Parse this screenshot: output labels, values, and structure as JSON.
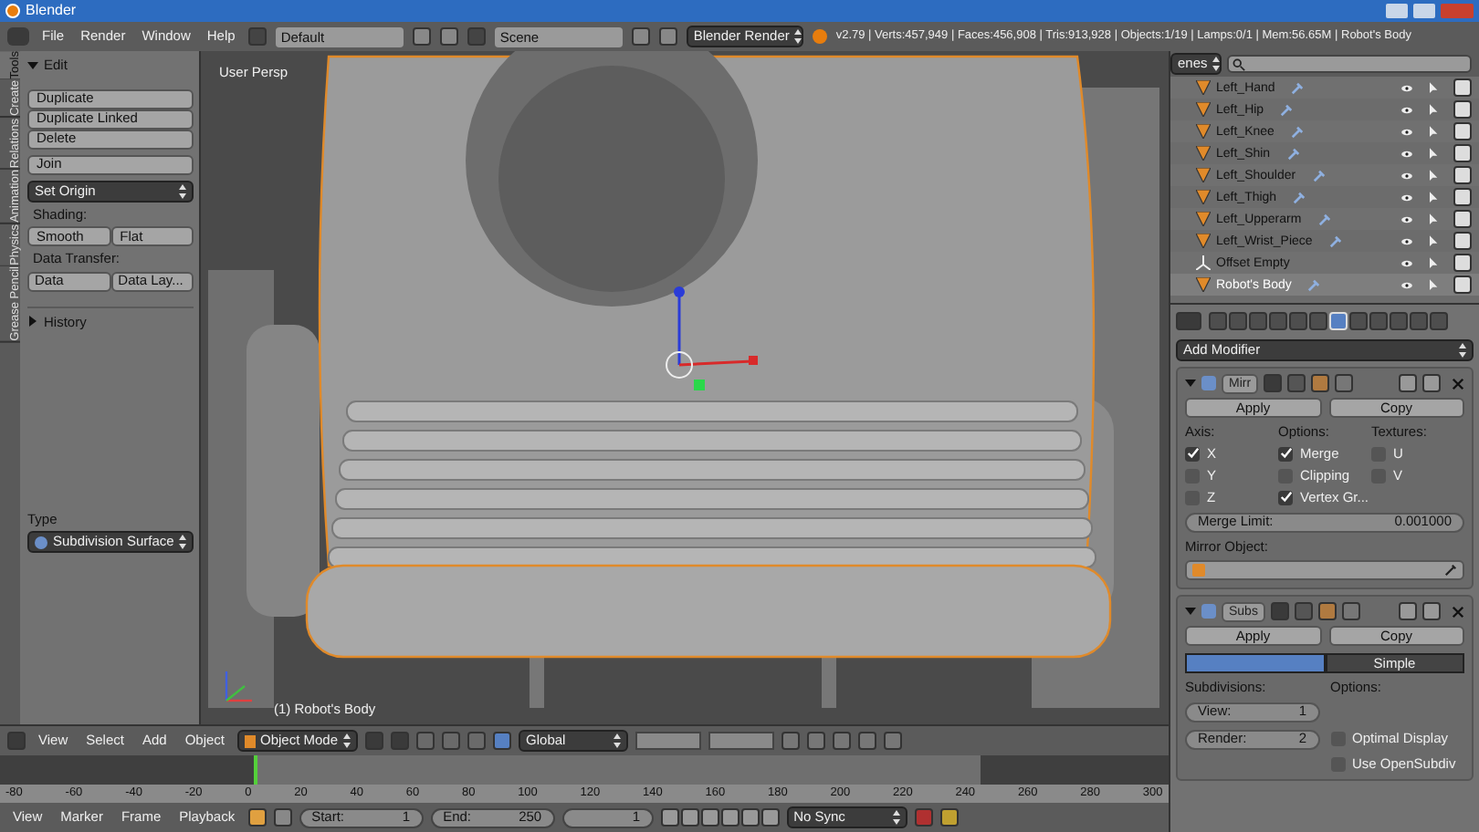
{
  "window": {
    "title": "Blender"
  },
  "menu_bar": {
    "menus": [
      "File",
      "Render",
      "Window",
      "Help"
    ],
    "layout": "Default",
    "scene": "Scene",
    "engine": "Blender Render",
    "stats": "v2.79 | Verts:457,949 | Faces:456,908 | Tris:913,928 | Objects:1/19 | Lamps:0/1 | Mem:56.65M | Robot's Body"
  },
  "tool_shelf": {
    "tabs": [
      {
        "label": "Tools",
        "selected": true
      },
      {
        "label": "Create",
        "selected": false
      },
      {
        "label": "Relations",
        "selected": false
      },
      {
        "label": "Animation",
        "selected": false
      },
      {
        "label": "Physics",
        "selected": false
      },
      {
        "label": "Grease Pencil",
        "selected": false
      }
    ],
    "edit_panel": {
      "title": "Edit",
      "expanded": true,
      "buttons": [
        "Duplicate",
        "Duplicate Linked",
        "Delete"
      ],
      "join": "Join",
      "set_origin": "Set Origin",
      "shading_label": "Shading:",
      "shading_buttons": [
        "Smooth",
        "Flat"
      ],
      "data_transfer_label": "Data Transfer:",
      "data_transfer_buttons": [
        "Data",
        "Data Lay..."
      ]
    },
    "history_panel": {
      "title": "History",
      "expanded": false
    },
    "operator": {
      "label": "Type",
      "value": "Subdivision Surface"
    }
  },
  "viewport": {
    "view_name": "User Persp",
    "object_label": "(1) Robot's Body"
  },
  "view3d_header": {
    "menus": [
      "View",
      "Select",
      "Add",
      "Object"
    ],
    "mode": "Object Mode",
    "orientation": "Global"
  },
  "timeline": {
    "ruler": [
      "-80",
      "-60",
      "-40",
      "-20",
      "0",
      "20",
      "40",
      "60",
      "80",
      "100",
      "120",
      "140",
      "160",
      "180",
      "200",
      "220",
      "240",
      "260",
      "280",
      "300"
    ]
  },
  "timeline_header": {
    "menus": [
      "View",
      "Marker",
      "Frame",
      "Playback"
    ],
    "start": {
      "label": "Start:",
      "value": "1"
    },
    "end": {
      "label": "End:",
      "value": "250"
    },
    "frame": "1",
    "sync": "No Sync"
  },
  "outliner": {
    "display_mode": "enes",
    "rows": [
      {
        "name": "Left_Hand",
        "kind": "bone",
        "selected": false
      },
      {
        "name": "Left_Hip",
        "kind": "bone",
        "selected": false
      },
      {
        "name": "Left_Knee",
        "kind": "bone",
        "selected": false
      },
      {
        "name": "Left_Shin",
        "kind": "bone",
        "selected": false
      },
      {
        "name": "Left_Shoulder",
        "kind": "bone",
        "selected": false
      },
      {
        "name": "Left_Thigh",
        "kind": "bone",
        "selected": false
      },
      {
        "name": "Left_Upperarm",
        "kind": "bone",
        "selected": false
      },
      {
        "name": "Left_Wrist_Piece",
        "kind": "bone",
        "selected": false
      },
      {
        "name": "Offset Empty",
        "kind": "empty",
        "selected": false
      },
      {
        "name": "Robot's Body",
        "kind": "bone",
        "selected": true
      }
    ]
  },
  "properties": {
    "tabs": [
      {
        "selected": false
      },
      {
        "selected": false
      },
      {
        "selected": false
      },
      {
        "selected": false
      },
      {
        "selected": false
      },
      {
        "selected": false
      },
      {
        "selected": true
      },
      {
        "selected": false
      },
      {
        "selected": false
      },
      {
        "selected": false
      },
      {
        "selected": false
      },
      {
        "selected": false
      }
    ],
    "add_modifier": "Add Modifier",
    "modifiers": [
      {
        "kind": "mirror",
        "name": "Mirr",
        "expanded": true,
        "apply": "Apply",
        "copy": "Copy",
        "axis_label": "Axis:",
        "axes": [
          {
            "label": "X",
            "checked": true
          },
          {
            "label": "Y",
            "checked": false
          },
          {
            "label": "Z",
            "checked": false
          }
        ],
        "options_label": "Options:",
        "options": [
          {
            "label": "Merge",
            "checked": true
          },
          {
            "label": "Clipping",
            "checked": false
          },
          {
            "label": "Vertex Gr...",
            "checked": true
          }
        ],
        "textures_label": "Textures:",
        "textures": [
          {
            "label": "U",
            "checked": false
          },
          {
            "label": "V",
            "checked": false
          }
        ],
        "merge_limit": {
          "label": "Merge Limit:",
          "value": "0.001000"
        },
        "mirror_object_label": "Mirror Object:"
      },
      {
        "kind": "subsurf",
        "name": "Subs",
        "expanded": true,
        "apply": "Apply",
        "copy": "Copy",
        "types": [
          {
            "selected": true
          },
          {
            "label": "Simple",
            "selected": false
          }
        ],
        "subdivisions_label": "Subdivisions:",
        "view": {
          "label": "View:",
          "value": "1"
        },
        "render": {
          "label": "Render:",
          "value": "2"
        },
        "options_label": "Options:",
        "options": [
          {
            "label": "Optimal Display",
            "checked": false
          },
          {
            "label": "Use OpenSubdiv",
            "checked": false
          }
        ]
      }
    ]
  }
}
